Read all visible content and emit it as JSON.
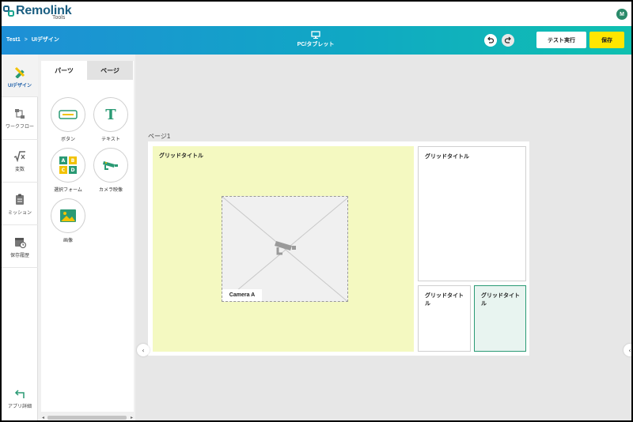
{
  "brand": {
    "name": "Remolink",
    "sub": "Tools"
  },
  "user": {
    "initial": "M"
  },
  "breadcrumb": {
    "project": "Test1",
    "separator": ">",
    "current": "UIデザイン"
  },
  "device": {
    "label": "PC/タブレット"
  },
  "toolbar": {
    "test_label": "テスト実行",
    "save_label": "保存"
  },
  "nav": {
    "items": [
      {
        "label": "UIデザイン"
      },
      {
        "label": "ワークフロー"
      },
      {
        "label": "変数"
      },
      {
        "label": "ミッション"
      },
      {
        "label": "保存履歴"
      }
    ],
    "app_detail": "アプリ詳細"
  },
  "panel": {
    "tabs": [
      {
        "label": "パーツ"
      },
      {
        "label": "ページ"
      }
    ],
    "parts": [
      {
        "label": "ボタン",
        "icon": "button-icon"
      },
      {
        "label": "テキスト",
        "icon": "text-icon"
      },
      {
        "label": "選択フォーム",
        "icon": "select-form-icon"
      },
      {
        "label": "カメラ映像",
        "icon": "camera-icon"
      },
      {
        "label": "画像",
        "icon": "image-icon"
      }
    ],
    "text_glyph": "T",
    "select_letters": [
      "A",
      "B",
      "C",
      "D"
    ]
  },
  "canvas": {
    "page_label": "ページ1",
    "grids": [
      {
        "title": "グリッドタイトル"
      },
      {
        "title": "グリッドタイトル"
      },
      {
        "title": "グリッドタイトル"
      },
      {
        "title": "グリッドタイトル"
      }
    ],
    "camera_label": "Camera A",
    "collapse_glyph": "‹"
  },
  "colors": {
    "accent_green": "#2a9a74",
    "save_yellow": "#ffe600",
    "grid_highlight": "#f4f9c1",
    "brand_blue": "#1c5f82"
  }
}
